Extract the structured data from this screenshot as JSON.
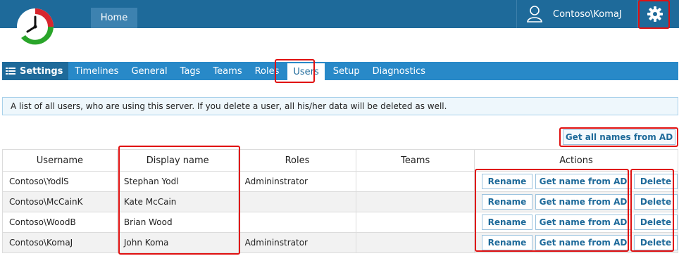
{
  "header": {
    "home_tab": "Home",
    "user_name": "Contoso\\KomaJ",
    "user_icon": "user-icon",
    "gear_icon": "gear-icon",
    "brand_colors": {
      "bar": "#1e6a9a",
      "logo_green": "#2aa52a",
      "logo_red": "#d7262e"
    }
  },
  "settings_nav": {
    "label": "Settings",
    "tabs": [
      {
        "label": "Timelines",
        "active": false
      },
      {
        "label": "General",
        "active": false
      },
      {
        "label": "Tags",
        "active": false
      },
      {
        "label": "Teams",
        "active": false
      },
      {
        "label": "Roles",
        "active": false
      },
      {
        "label": "Users",
        "active": true
      },
      {
        "label": "Setup",
        "active": false
      },
      {
        "label": "Diagnostics",
        "active": false
      }
    ]
  },
  "info_text": "A list of all users, who are using this server. If you delete a user, all his/her data will be deleted as well.",
  "get_all_button": "Get all names from AD",
  "table": {
    "headers": [
      "Username",
      "Display name",
      "Roles",
      "Teams",
      "Actions"
    ],
    "rows": [
      {
        "username": "Contoso\\YodlS",
        "display_name": "Stephan Yodl",
        "roles": "Admininstrator",
        "teams": ""
      },
      {
        "username": "Contoso\\McCainK",
        "display_name": "Kate McCain",
        "roles": "",
        "teams": ""
      },
      {
        "username": "Contoso\\WoodB",
        "display_name": "Brian Wood",
        "roles": "",
        "teams": ""
      },
      {
        "username": "Contoso\\KomaJ",
        "display_name": "John Koma",
        "roles": "Admininstrator",
        "teams": ""
      }
    ],
    "actions": {
      "rename": "Rename",
      "get_name": "Get name from AD",
      "delete": "Delete"
    }
  }
}
